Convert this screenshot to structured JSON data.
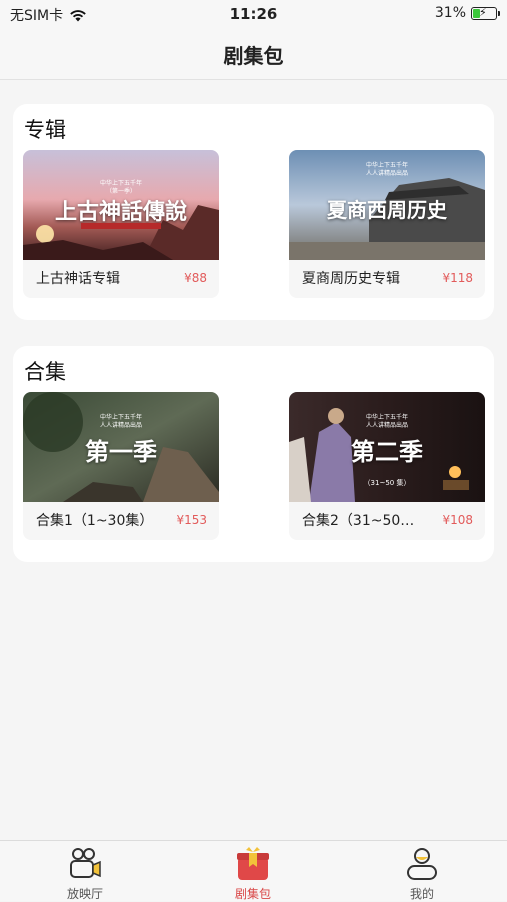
{
  "status_bar": {
    "carrier": "无SIM卡",
    "time": "11:26",
    "battery_percent": "31%"
  },
  "header": {
    "title": "剧集包"
  },
  "sections": [
    {
      "title": "专辑",
      "items": [
        {
          "name": "上古神话专辑",
          "price": "¥88",
          "thumb_title": "上古神話傳說",
          "thumb_series": "中华上下五千年",
          "thumb_sub": "（第一季）"
        },
        {
          "name": "夏商周历史专辑",
          "price": "¥118",
          "thumb_title": "夏商西周历史",
          "thumb_series": "中华上下五千年",
          "thumb_sub": "人人讲精品出品"
        }
      ]
    },
    {
      "title": "合集",
      "items": [
        {
          "name": "合集1（1~30集）",
          "price": "¥153",
          "thumb_title": "第一季",
          "thumb_series": "中华上下五千年",
          "thumb_sub": "人人讲精品出品",
          "thumb_eps": ""
        },
        {
          "name": "合集2（31~50…",
          "price": "¥108",
          "thumb_title": "第二季",
          "thumb_series": "中华上下五千年",
          "thumb_sub": "人人讲精品出品",
          "thumb_eps": "（31~50 集）"
        }
      ]
    }
  ],
  "tab_bar": {
    "tabs": [
      {
        "label": "放映厅",
        "icon": "camera-icon",
        "active": false
      },
      {
        "label": "剧集包",
        "icon": "gift-box-icon",
        "active": true
      },
      {
        "label": "我的",
        "icon": "user-icon",
        "active": false
      }
    ]
  },
  "colors": {
    "accent": "#d94747",
    "price": "#e25b5b",
    "background": "#f5f5f5"
  }
}
